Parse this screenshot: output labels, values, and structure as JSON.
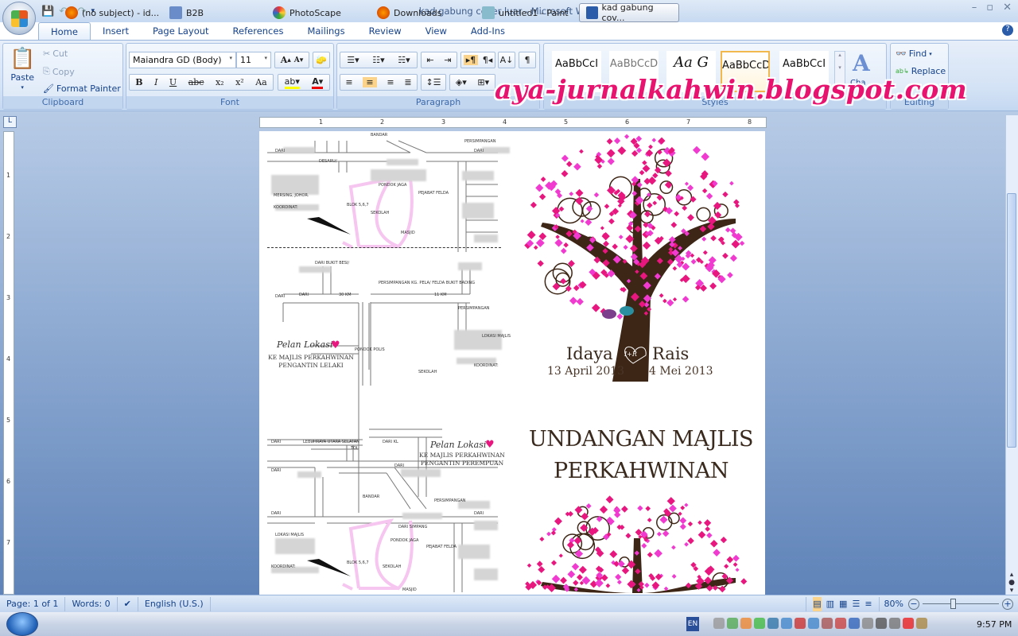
{
  "window": {
    "title": "kad gabung cover luar - Microsoft Word"
  },
  "quick_access": {
    "icons": [
      "save-icon",
      "undo-icon",
      "redo-icon",
      "customize-icon"
    ]
  },
  "tabs": [
    {
      "label": "Home",
      "active": true
    },
    {
      "label": "Insert"
    },
    {
      "label": "Page Layout"
    },
    {
      "label": "References"
    },
    {
      "label": "Mailings"
    },
    {
      "label": "Review"
    },
    {
      "label": "View"
    },
    {
      "label": "Add-Ins"
    }
  ],
  "clipboard": {
    "group": "Clipboard",
    "paste": "Paste",
    "cut": "Cut",
    "copy": "Copy",
    "format_painter": "Format Painter"
  },
  "font": {
    "group": "Font",
    "name": "Maiandra GD (Body)",
    "size": "11",
    "bold": "B",
    "italic": "I",
    "underline": "U",
    "strike": "abc",
    "sub": "x₂",
    "sup": "x²",
    "case": "Aa",
    "grow": "A",
    "shrink": "A"
  },
  "paragraph": {
    "group": "Paragraph"
  },
  "styles": {
    "group": "Styles",
    "items": [
      {
        "preview": "AaBbCcI"
      },
      {
        "preview": "AaBbCcD"
      },
      {
        "preview": "Aa G"
      },
      {
        "preview": "AaBbCcD",
        "selected": true
      },
      {
        "preview": "AaBbCcI"
      }
    ],
    "change_styles": "Cha"
  },
  "editing": {
    "group": "Editing",
    "find": "Find",
    "replace": "Replace"
  },
  "watermark": "aya-jurnalkahwin.blogspot.com",
  "ruler_numbers": [
    "1",
    "2",
    "3",
    "4",
    "5",
    "6",
    "7",
    "8"
  ],
  "document": {
    "map1": {
      "labels": [
        "BANDAR",
        "PERSIMPANGAN",
        "DARI",
        "DARI",
        "DESARU/",
        "PONDOK JAGA",
        "PEJABAT FELDA",
        "MERSING, JOHOR.",
        "KOORDINAT:",
        "BLOK 5,6,7",
        "SEKOLAH",
        "MASJID"
      ]
    },
    "map2": {
      "labels": [
        "DARI BUKIT BESI/",
        "DARI",
        "PERSIMPANGAN KG. PELA/ FELDA BUKIT BADING",
        "DARI",
        "30 KM",
        "11 KM",
        "PERSIMPANGAN",
        "LOKASI MAJLIS",
        "KOORDINAT:",
        "PONDOK POLIS",
        "SEKOLAH"
      ],
      "pelan": "Pelan Lokasi",
      "caption1": "KE MAJLIS PERKAHWINAN",
      "caption2": "PENGANTIN LELAKI"
    },
    "map3": {
      "labels": [
        "DARI",
        "LEBUHRAYA UTARA SELATAN",
        "DARI KL",
        "TOL",
        "DARI",
        "DARI",
        "BANDAR",
        "DARI",
        "PERSIMPANGAN",
        "DARI",
        "DARI SIMPANG",
        "LOKASI MAJLIS",
        "PONDOK JAGA",
        "PEJABAT FELDA",
        "KOORDINAT:",
        "BLOK 5,6,7",
        "SEKOLAH",
        "MASJID"
      ],
      "pelan": "Pelan Lokasi",
      "caption1": "KE MAJLIS PERKAHWINAN",
      "caption2": "PENGANTIN PEREMPUAN"
    },
    "bride": "Idaya",
    "groom": "Rais",
    "initials": "I+R",
    "date_bride": "13 April 2013",
    "date_groom": "4 Mei 2013",
    "title1": "UNDANGAN MAJLIS",
    "title2": "PERKAHWINAN",
    "colors": {
      "blossom": "#e8177f",
      "blossom2": "#f03ad0",
      "trunk": "#3d2616",
      "bird1": "#7b3f8c",
      "bird2": "#2a8fa0"
    }
  },
  "status": {
    "page": "Page: 1 of 1",
    "words": "Words: 0",
    "language": "English (U.S.)",
    "zoom": "80%",
    "zoom_percent": 80
  },
  "taskbar": {
    "items": [
      {
        "label": "(no subject) - id...",
        "icon": "firefox-icon"
      },
      {
        "label": "B2B",
        "icon": "app-icon"
      },
      {
        "label": "PhotoScape",
        "icon": "photoscape-icon"
      },
      {
        "label": "Downloads",
        "icon": "firefox-icon"
      },
      {
        "label": "untitled1 - Paint",
        "icon": "paint-icon"
      },
      {
        "label": "kad gabung cov...",
        "icon": "word-icon",
        "active": true
      }
    ],
    "lang": "EN",
    "clock": "9:57 PM"
  }
}
